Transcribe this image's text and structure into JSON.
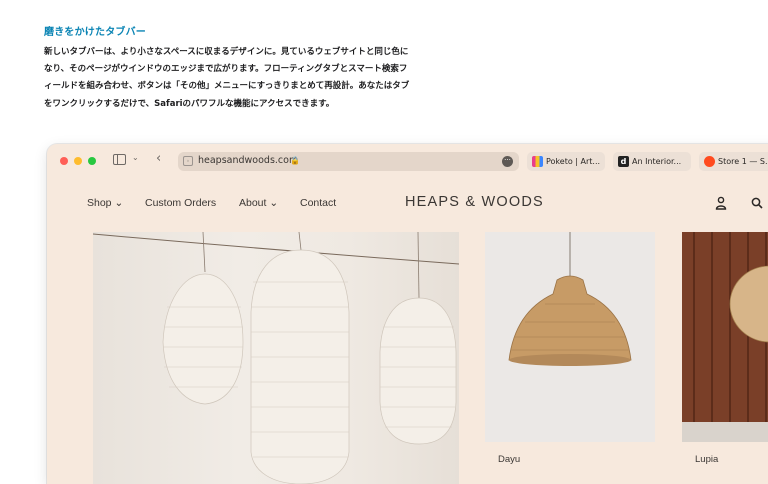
{
  "intro": {
    "title": "磨きをかけたタブバー",
    "lines": [
      "新しいタブバーは、より小さなスペースに収まるデザインに。見ているウェブサイトと同じ色に",
      "なり、そのページがウインドウのエッジまで広がります。フローティングタブとスマート検索フ",
      "ィールドを組み合わせ、ボタンは「その他」メニューにすっきりまとめて再設計。あなたはタブ",
      "をワンクリックするだけで、Safariのパワフルな機能にアクセスできます。"
    ]
  },
  "browser": {
    "url": "heapsandwoods.com",
    "tabs": [
      {
        "label": "Poketo | Art..."
      },
      {
        "label": "An Interior..."
      },
      {
        "label": "Store 1 — S..."
      }
    ],
    "interior_icon_letter": "d",
    "accent_bg": "#f7e9dd"
  },
  "site": {
    "nav": {
      "shop": "Shop",
      "custom_orders": "Custom Orders",
      "about": "About",
      "contact": "Contact"
    },
    "logo": "HEAPS & WOODS",
    "products": [
      {
        "name": "Dayu"
      },
      {
        "name": "Lupia"
      }
    ]
  }
}
